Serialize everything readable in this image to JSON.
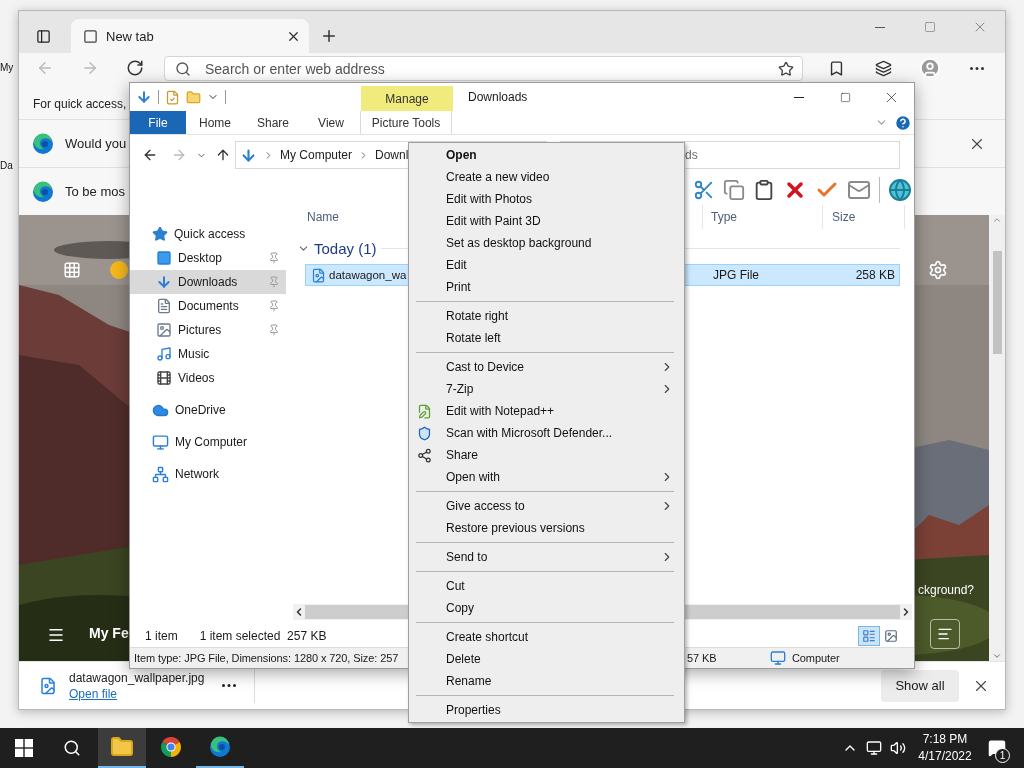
{
  "desktop": {
    "labels": [
      "My",
      "Da"
    ]
  },
  "browser": {
    "tab": {
      "title": "New tab",
      "selected": true
    },
    "address": {
      "placeholder": "Search or enter web address"
    },
    "favorites_hint": "For quick access,",
    "notifications": [
      {
        "text": "Would you",
        "closable": true
      },
      {
        "text": "To be mos",
        "closable": false
      }
    ],
    "feed": {
      "title": "My Fe",
      "prompt": "ckground?"
    },
    "download": {
      "file": "datawagon_wallpaper.jpg",
      "link": "Open file",
      "button": "Show all"
    }
  },
  "explorer": {
    "title": "Downloads",
    "ribbon": [
      {
        "label": "File",
        "kind": "file"
      },
      {
        "label": "Home",
        "kind": "tab"
      },
      {
        "label": "Share",
        "kind": "tab"
      },
      {
        "label": "View",
        "kind": "tab"
      },
      {
        "label": "Picture Tools",
        "kind": "context",
        "header": "Manage"
      }
    ],
    "breadcrumb": [
      "My Computer",
      "Downl"
    ],
    "search": {
      "placeholder": "ds"
    },
    "nav": [
      {
        "label": "Quick access",
        "kind": "quick",
        "selected": false,
        "pinned": false,
        "children": [
          {
            "label": "Desktop",
            "kind": "desktop",
            "selected": false,
            "pinned": true
          },
          {
            "label": "Downloads",
            "kind": "downloads",
            "selected": true,
            "pinned": true
          },
          {
            "label": "Documents",
            "kind": "documents",
            "selected": false,
            "pinned": true
          },
          {
            "label": "Pictures",
            "kind": "pictures",
            "selected": false,
            "pinned": true
          },
          {
            "label": "Music",
            "kind": "music",
            "selected": false,
            "pinned": false
          },
          {
            "label": "Videos",
            "kind": "videos",
            "selected": false,
            "pinned": false
          }
        ]
      },
      {
        "label": "OneDrive",
        "kind": "cloud",
        "selected": false,
        "pinned": false
      },
      {
        "label": "My Computer",
        "kind": "computer",
        "selected": false,
        "pinned": false
      },
      {
        "label": "Network",
        "kind": "network",
        "selected": false,
        "pinned": false
      }
    ],
    "columns": [
      "Name",
      "Type",
      "Size"
    ],
    "groups": [
      {
        "label": "Today (1)",
        "expanded": true,
        "files": [
          {
            "name": "datawagon_wa",
            "type": "JPG File",
            "size": "258 KB",
            "selected": true
          }
        ]
      }
    ],
    "status": {
      "count": "1 item",
      "selection": "1 item selected  257 KB"
    },
    "views": [
      {
        "selected": true
      },
      {
        "selected": false
      }
    ],
    "details": {
      "info": "Item type: JPG File, Dimensions: 1280 x 720, Size: 257",
      "size": "57 KB",
      "location": "Computer"
    }
  },
  "context_menu": [
    {
      "kind": "default",
      "label": "Open"
    },
    {
      "kind": "item",
      "label": "Create a new video"
    },
    {
      "kind": "item",
      "label": "Edit with Photos"
    },
    {
      "kind": "item",
      "label": "Edit with Paint 3D"
    },
    {
      "kind": "item",
      "label": "Set as desktop background"
    },
    {
      "kind": "item",
      "label": "Edit"
    },
    {
      "kind": "item",
      "label": "Print"
    },
    {
      "kind": "separator"
    },
    {
      "kind": "item",
      "label": "Rotate right"
    },
    {
      "kind": "item",
      "label": "Rotate left"
    },
    {
      "kind": "separator"
    },
    {
      "kind": "submenu",
      "label": "Cast to Device"
    },
    {
      "kind": "submenu",
      "label": "7-Zip"
    },
    {
      "kind": "icon",
      "label": "Edit with Notepad++"
    },
    {
      "kind": "icon",
      "label": "Scan with Microsoft Defender..."
    },
    {
      "kind": "icon",
      "label": "Share"
    },
    {
      "kind": "submenu",
      "label": "Open with"
    },
    {
      "kind": "separator"
    },
    {
      "kind": "submenu",
      "label": "Give access to"
    },
    {
      "kind": "item",
      "label": "Restore previous versions"
    },
    {
      "kind": "separator"
    },
    {
      "kind": "submenu",
      "label": "Send to"
    },
    {
      "kind": "separator"
    },
    {
      "kind": "item",
      "label": "Cut"
    },
    {
      "kind": "item",
      "label": "Copy"
    },
    {
      "kind": "separator"
    },
    {
      "kind": "item",
      "label": "Create shortcut"
    },
    {
      "kind": "item",
      "label": "Delete"
    },
    {
      "kind": "item",
      "label": "Rename"
    },
    {
      "kind": "separator"
    },
    {
      "kind": "item",
      "label": "Properties"
    }
  ],
  "taskbar": {
    "apps": [
      {
        "selected": true,
        "running": true
      },
      {
        "selected": false,
        "running": false
      },
      {
        "selected": false,
        "running": true
      }
    ],
    "time": "7:18 PM",
    "date": "4/17/2022",
    "notification_count": "1"
  }
}
